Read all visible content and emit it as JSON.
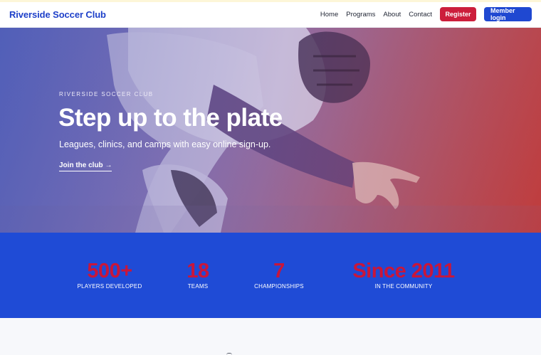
{
  "navbar": {
    "brand": "Riverside Soccer Club",
    "links": [
      "Home",
      "Programs",
      "About",
      "Contact"
    ],
    "register_label": "Register",
    "member_login_label": "Member login"
  },
  "hero": {
    "eyebrow": "RIVERSIDE SOCCER CLUB",
    "title": "Step up to the plate",
    "subtitle": "Leagues, clinics, and camps with easy online sign-up.",
    "cta_label": "Join the club →",
    "image_subject": "baseball-catcher-photo"
  },
  "stats": [
    {
      "value": "500+",
      "label": "PLAYERS DEVELOPED"
    },
    {
      "value": "18",
      "label": "TEAMS"
    },
    {
      "value": "7",
      "label": "CHAMPIONSHIPS"
    },
    {
      "value": "Since 2011",
      "label": "IN THE COMMUNITY"
    }
  ],
  "colors": {
    "brand_blue": "#1e40c9",
    "register_red": "#cc1e3b",
    "member_blue": "#1f48d1",
    "stats_band": "#1f4bd6",
    "stat_value_red": "#c9163a"
  }
}
